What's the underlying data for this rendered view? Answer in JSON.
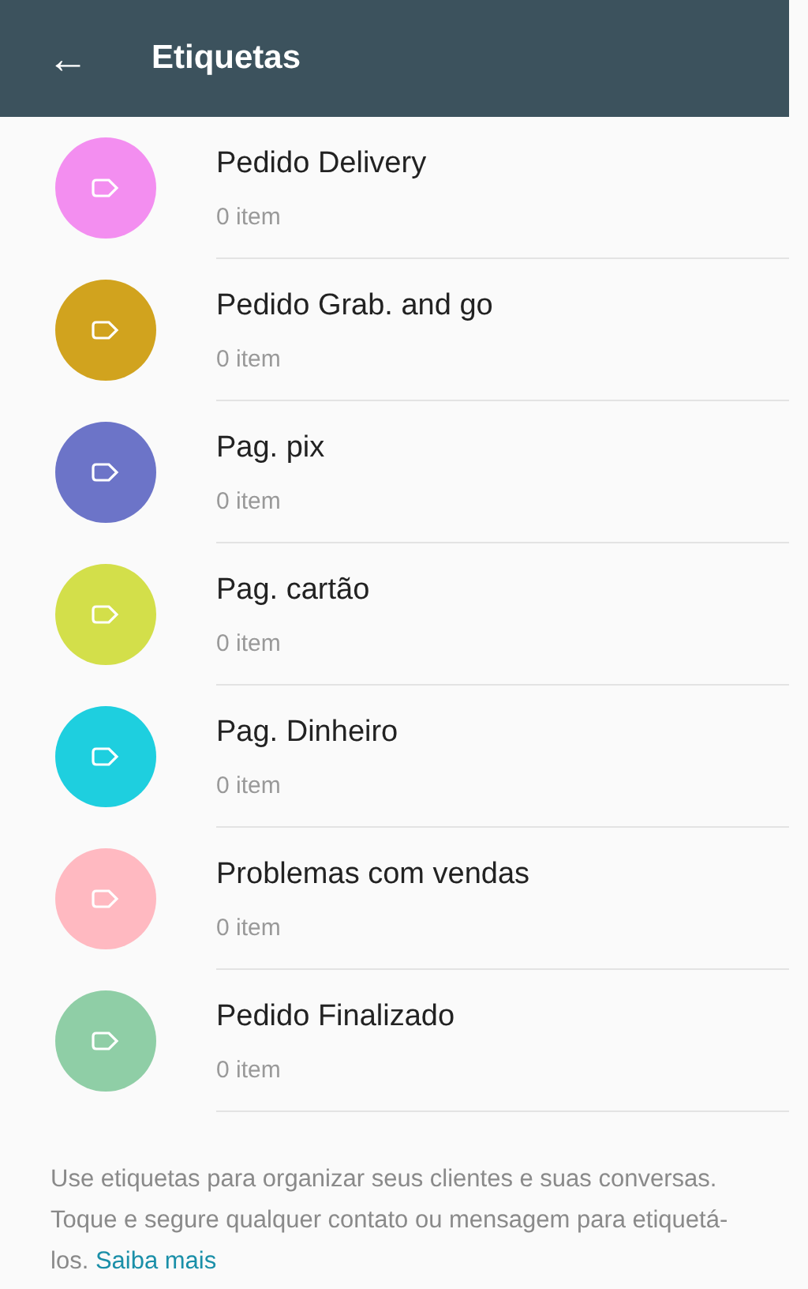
{
  "header": {
    "back": "←",
    "title": "Etiquetas"
  },
  "labels": [
    {
      "name": "Pedido Delivery",
      "count": "0 item",
      "color": "#f38ef0"
    },
    {
      "name": "Pedido Grab. and go",
      "count": "0 item",
      "color": "#d1a31e"
    },
    {
      "name": "Pag. pix",
      "count": "0 item",
      "color": "#6c74c8"
    },
    {
      "name": "Pag. cartão",
      "count": "0 item",
      "color": "#d3df4a"
    },
    {
      "name": "Pag. Dinheiro",
      "count": "0 item",
      "color": "#1ecfdf"
    },
    {
      "name": "Problemas com vendas",
      "count": "0 item",
      "color": "#ffb9c1"
    },
    {
      "name": "Pedido Finalizado",
      "count": "0 item",
      "color": "#8fcea6"
    }
  ],
  "footer": {
    "text": "Use etiquetas para organizar seus clientes e suas conversas. Toque e segure qualquer contato ou mensagem para etiquetá-los.",
    "link": "Saiba mais"
  }
}
